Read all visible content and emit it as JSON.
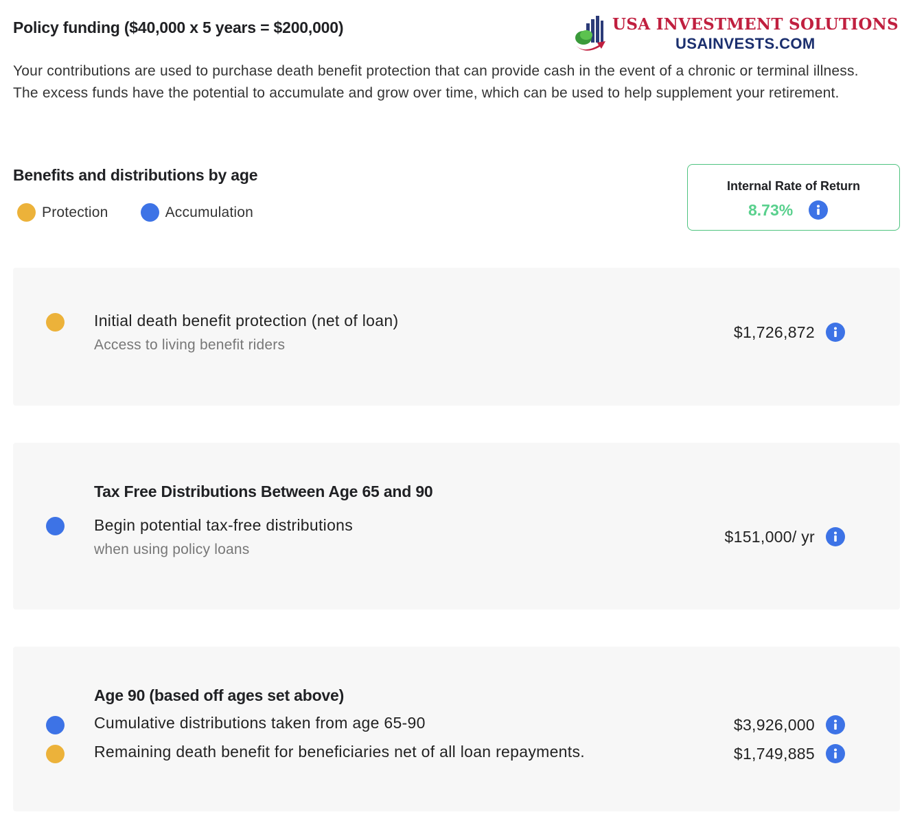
{
  "header": {
    "title": "Policy funding ($40,000 x 5 years = $200,000)",
    "logo": {
      "line1": "USA INVESTMENT SOLUTIONS",
      "line2": "USAINVESTS.COM"
    }
  },
  "intro": "Your contributions are used to purchase death benefit protection that can provide cash in the event of a chronic or terminal illness. The excess funds have the potential to accumulate and grow over time, which can be used to help supplement your retirement.",
  "benefits": {
    "title": "Benefits and distributions by age",
    "legend": [
      {
        "label": "Protection",
        "color": "#ecb23a"
      },
      {
        "label": "Accumulation",
        "color": "#3d73e6"
      }
    ]
  },
  "irr": {
    "label": "Internal Rate of Return",
    "value": "8.73%",
    "color": "#59d08d"
  },
  "cards": {
    "initial": {
      "main": "Initial death benefit protection (net of loan)",
      "sub": "Access to living benefit riders",
      "amount": "$1,726,872",
      "type": "protection"
    },
    "distributions": {
      "heading": "Tax Free Distributions Between Age 65 and 90",
      "main": "Begin potential tax-free distributions",
      "sub": "when using policy loans",
      "amount": "$151,000/ yr",
      "type": "accumulation"
    },
    "age90": {
      "heading": "Age 90 (based off ages set above)",
      "rows": [
        {
          "text": "Cumulative distributions taken from age 65-90",
          "amount": "$3,926,000",
          "type": "accumulation"
        },
        {
          "text": "Remaining death benefit for beneficiaries net of all loan repayments.",
          "amount": "$1,749,885",
          "type": "protection"
        }
      ]
    }
  },
  "icons": {
    "info": "info-icon",
    "logo": "chart-arrow-logo-icon"
  }
}
